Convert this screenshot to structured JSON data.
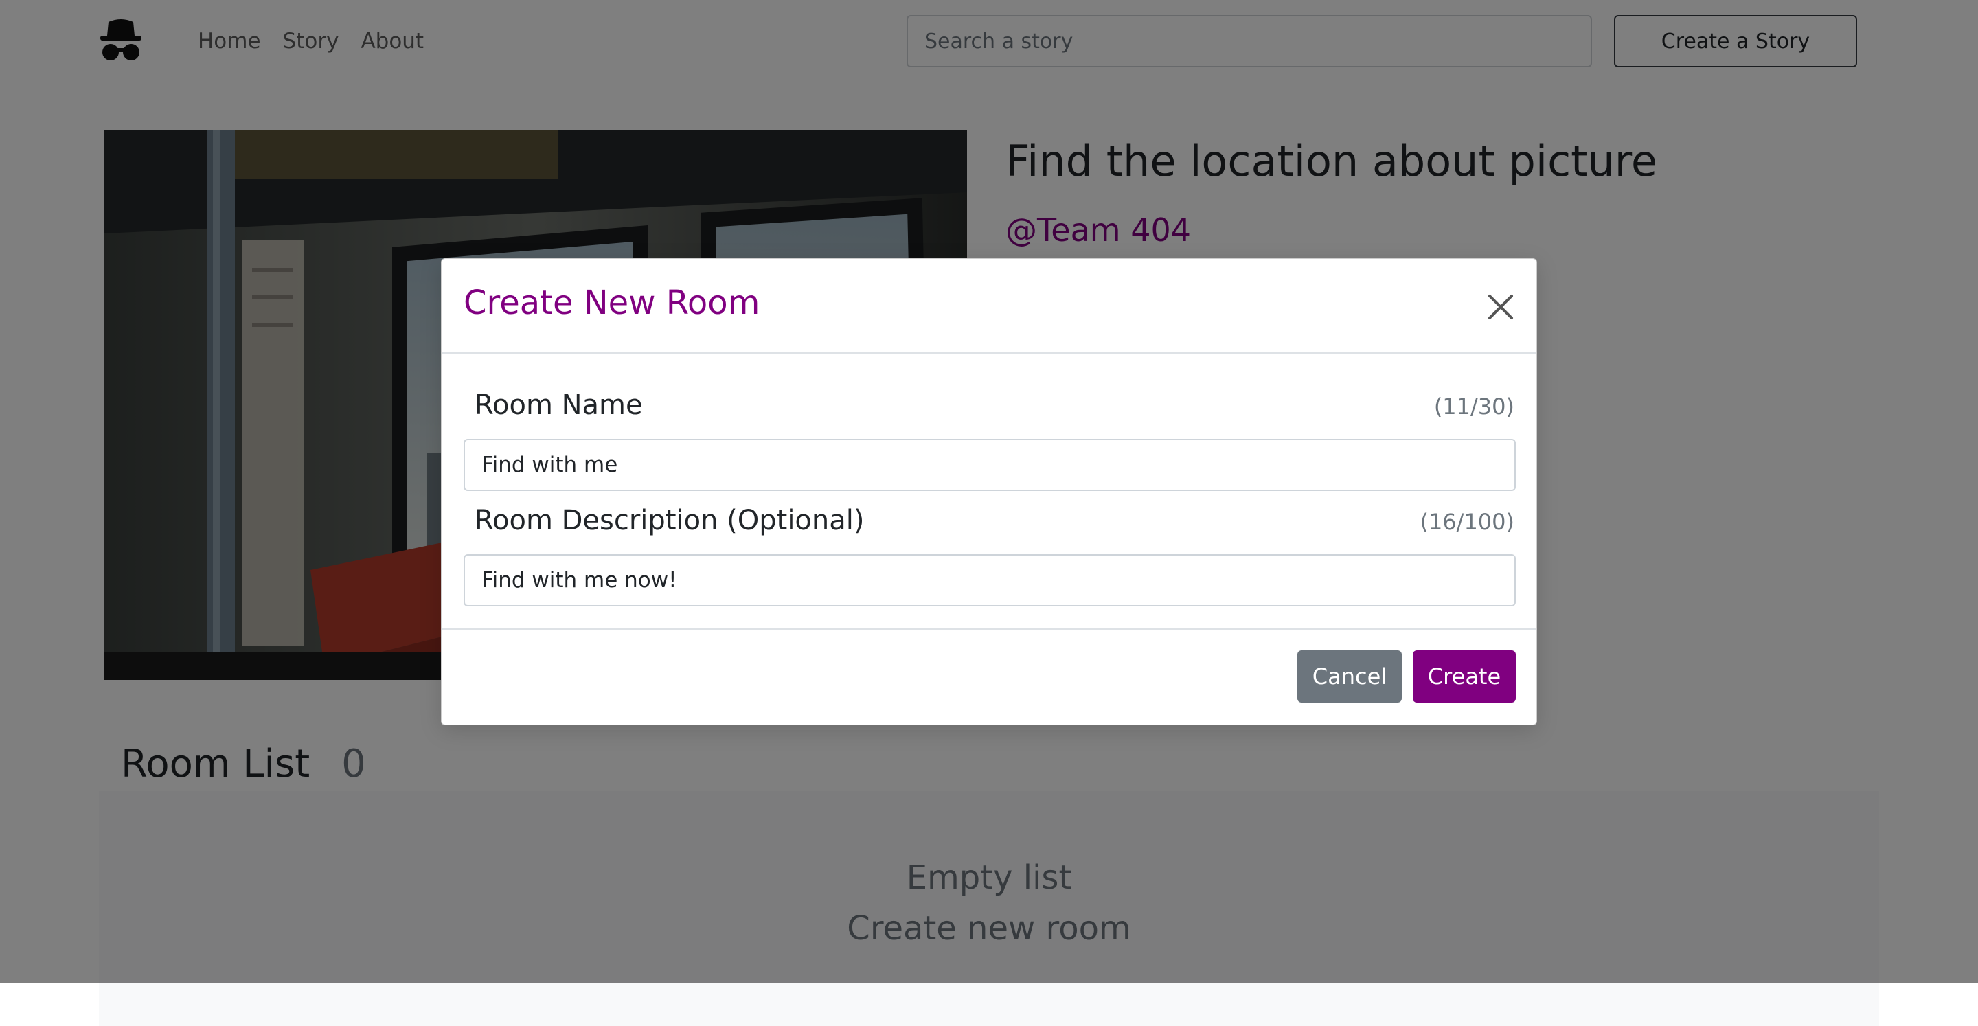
{
  "navbar": {
    "logo_icon": "spy-incognito-icon",
    "links": [
      "Home",
      "Story",
      "About"
    ],
    "search_placeholder": "Search a story",
    "create_story_label": "Create a Story"
  },
  "story": {
    "title": "Find the location about picture",
    "author": "@Team 404"
  },
  "room_list": {
    "title": "Room List",
    "count": "0",
    "empty_line1": "Empty list",
    "empty_line2": "Create new room"
  },
  "modal": {
    "title": "Create New Room",
    "close_icon": "close-icon",
    "room_name_label": "Room Name",
    "room_name_count": "(11/30)",
    "room_name_value": "Find with me",
    "room_desc_label": "Room Description (Optional)",
    "room_desc_count": "(16/100)",
    "room_desc_value": "Find with me now!",
    "cancel_label": "Cancel",
    "create_label": "Create"
  },
  "colors": {
    "accent": "#800080",
    "secondary": "#6c757d",
    "backdrop": "rgba(0,0,0,0.5)"
  }
}
